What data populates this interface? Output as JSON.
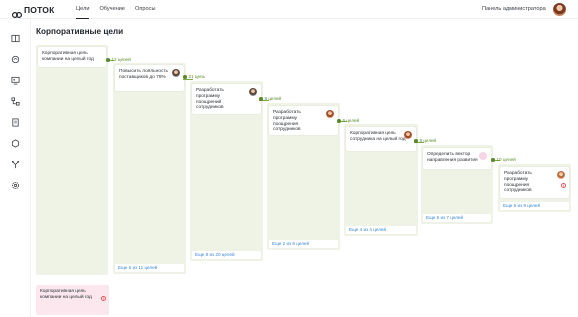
{
  "header": {
    "logo_text": "ПОТОК",
    "nav": [
      {
        "label": "Цели",
        "active": true
      },
      {
        "label": "Обучение",
        "active": false
      },
      {
        "label": "Опросы",
        "active": false
      }
    ],
    "admin_link": "Панель администратора"
  },
  "sidebar": {
    "icons": [
      "book-icon",
      "brain-icon",
      "presentation-icon",
      "hierarchy-icon",
      "document-icon",
      "badge-icon",
      "tree-icon",
      "settings-icon"
    ]
  },
  "page": {
    "title": "Корпоративные цели"
  },
  "columns": [
    {
      "card": {
        "text": "Корпоративная цель компании на целый год"
      },
      "footer": ""
    },
    {
      "header": "12 целей",
      "card": {
        "text": "Повысить лояльность поставщиков до 78%"
      },
      "footer": "Еще 5 из 11 целей"
    },
    {
      "header": "21 цель",
      "card": {
        "text": "Разработать программу поощрений сотрудников"
      },
      "footer": "Еще 8 из 20 целей"
    },
    {
      "header": "8 целей",
      "card": {
        "text": "Разработать программу поощрения сотрудников"
      },
      "footer": "Еще 2 из 8 целей"
    },
    {
      "header": "6 целей",
      "card": {
        "text": "Корпоративная цель сотрудника на целый год"
      },
      "footer": "Еще 4 из 4 целей"
    },
    {
      "header": "8 целей",
      "card": {
        "text": "Определить вектор направления развития"
      },
      "footer": "Еще 5 из 7 целей"
    },
    {
      "header": "10 целей",
      "card": {
        "text": "Разработать программу поощрения сотрудников"
      },
      "footer": "Еще 6 из 9 целей"
    }
  ],
  "extra_card": {
    "text": "Корпоративная цель компании на целый год",
    "status": "!"
  },
  "status_mark": "!",
  "colors": {
    "column_bg": "#eef3e6",
    "accent_green": "#5a8a2a",
    "link_blue": "#3a86d6",
    "alert_red": "#e05555"
  }
}
